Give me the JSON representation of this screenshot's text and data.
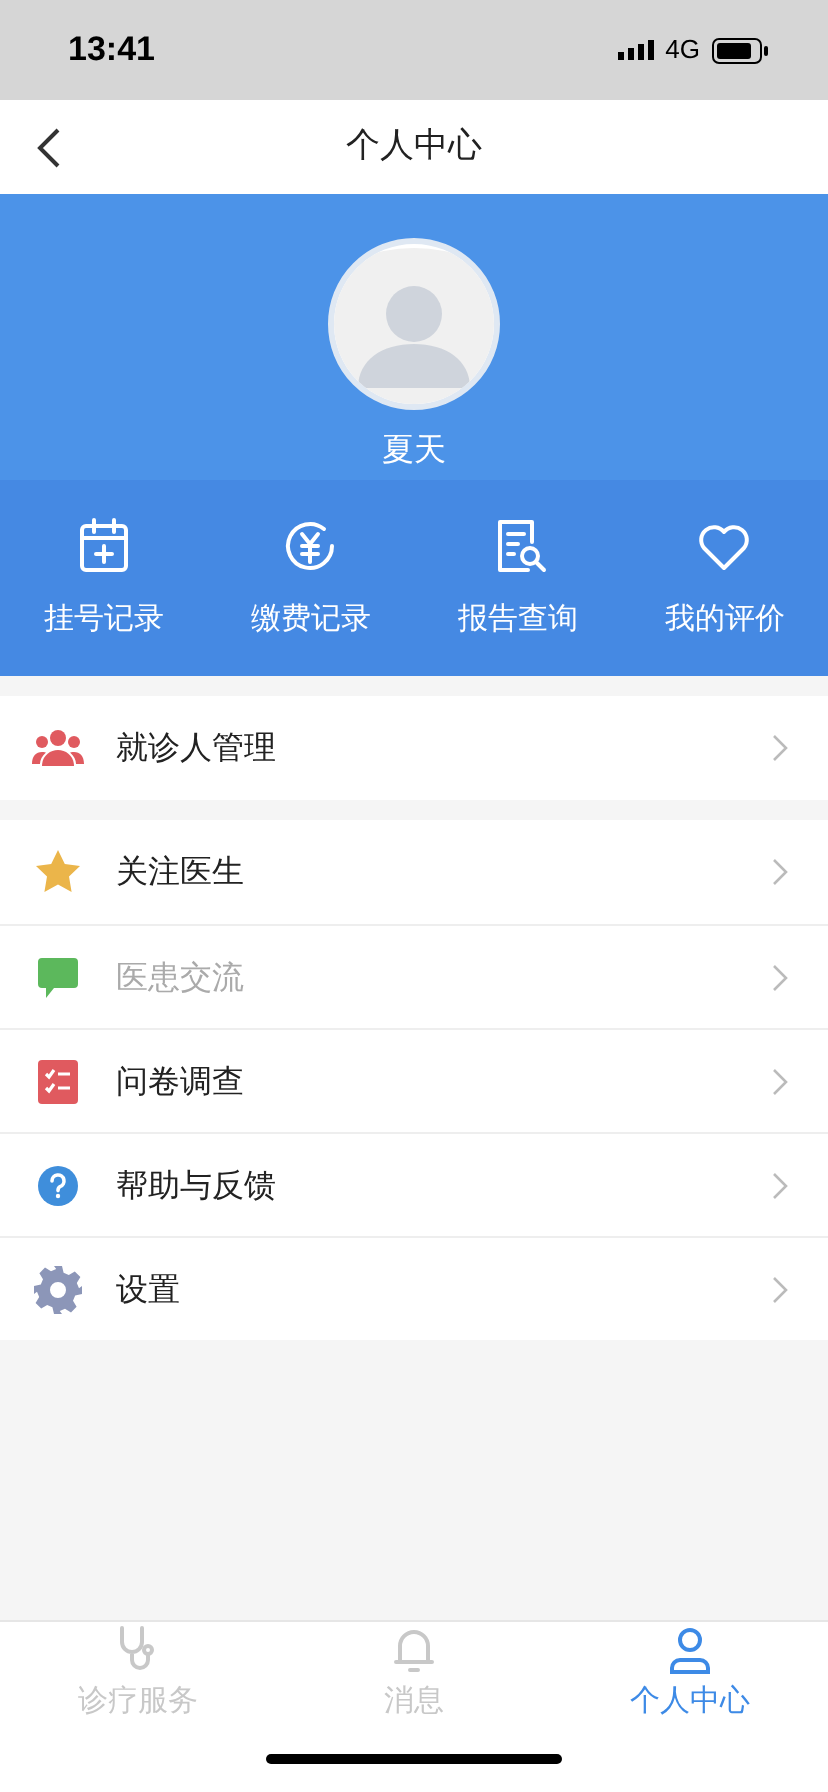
{
  "status_bar": {
    "time": "13:41",
    "network": "4G"
  },
  "nav": {
    "title": "个人中心"
  },
  "profile": {
    "name": "夏天"
  },
  "shortcuts": [
    {
      "kind": "calendar",
      "label": "挂号记录"
    },
    {
      "kind": "payment",
      "label": "缴费记录"
    },
    {
      "kind": "report",
      "label": "报告查询"
    },
    {
      "kind": "heart",
      "label": "我的评价"
    }
  ],
  "menu_groups": [
    [
      {
        "kind": "people",
        "label": "就诊人管理",
        "disabled": false
      }
    ],
    [
      {
        "kind": "star",
        "label": "关注医生",
        "disabled": false
      },
      {
        "kind": "chat",
        "label": "医患交流",
        "disabled": true
      },
      {
        "kind": "survey",
        "label": "问卷调查",
        "disabled": false
      },
      {
        "kind": "help",
        "label": "帮助与反馈",
        "disabled": false
      },
      {
        "kind": "settings",
        "label": "设置",
        "disabled": false
      }
    ]
  ],
  "tabs": [
    {
      "kind": "stethoscope",
      "label": "诊疗服务",
      "selected": false
    },
    {
      "kind": "bell",
      "label": "消息",
      "selected": false
    },
    {
      "kind": "person",
      "label": "个人中心",
      "selected": true
    }
  ]
}
